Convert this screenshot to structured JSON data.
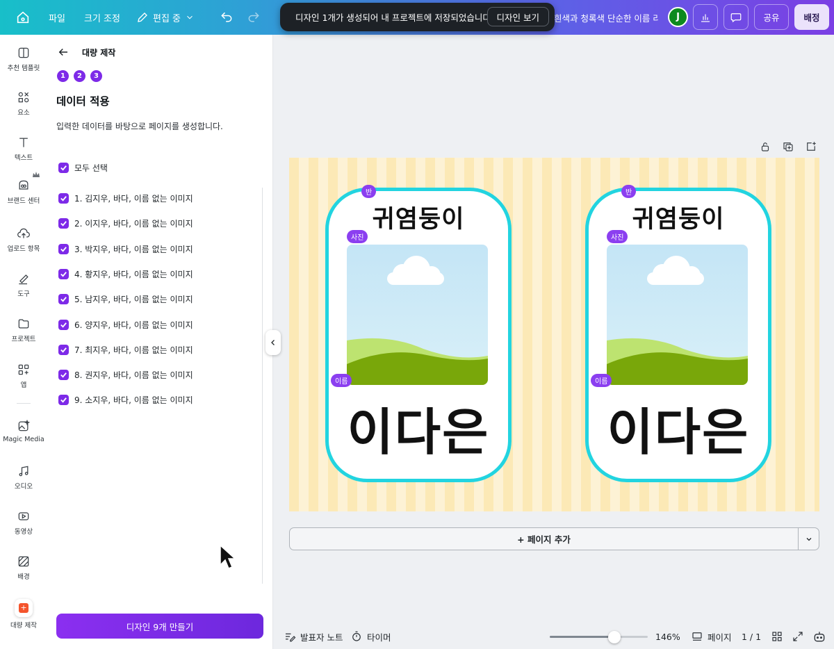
{
  "topbar": {
    "file": "파일",
    "resize": "크기 조정",
    "editing": "편집 중",
    "doc_title": "흰색과 청록색 단순한 이름 라벨",
    "avatar_initial": "J",
    "share": "공유",
    "publish": "배정"
  },
  "toast": {
    "message": "디자인 1개가 생성되어 내 프로젝트에 저장되었습니다",
    "action": "디자인 보기"
  },
  "rail": {
    "items": [
      {
        "label": "추천 템플릿"
      },
      {
        "label": "요소"
      },
      {
        "label": "텍스트"
      },
      {
        "label": "브랜드 센터"
      },
      {
        "label": "업로드 항목"
      },
      {
        "label": "도구"
      },
      {
        "label": "프로젝트"
      },
      {
        "label": "앱"
      },
      {
        "label": "Magic Media"
      },
      {
        "label": "오디오"
      },
      {
        "label": "동영상"
      },
      {
        "label": "배경"
      },
      {
        "label": "대량 제작"
      }
    ]
  },
  "panel": {
    "header": "대량 제작",
    "steps": [
      "1",
      "2",
      "3"
    ],
    "title": "데이터 적용",
    "description": "입력한 데이터를 바탕으로 페이지를 생성합니다.",
    "select_all": "모두 선택",
    "rows": [
      "1. 김지우, 바다, 이름 없는 이미지",
      "2. 이지우, 바다, 이름 없는 이미지",
      "3. 박지우, 바다, 이름 없는 이미지",
      "4. 황지우, 바다, 이름 없는 이미지",
      "5. 남지우, 바다, 이름 없는 이미지",
      "6. 양지우, 바다, 이름 없는 이미지",
      "7. 최지우, 바다, 이름 없는 이미지",
      "8. 권지우, 바다, 이름 없는 이미지",
      "9. 소지우, 바다, 이름 없는 이미지"
    ],
    "make_button": "디자인 9개 만들기"
  },
  "canvas": {
    "cards": [
      {
        "tag_class": "반",
        "title": "귀염둥이",
        "tag_photo": "사진",
        "tag_name": "이름",
        "name": "이다은"
      },
      {
        "tag_class": "반",
        "title": "귀염둥이",
        "tag_photo": "사진",
        "tag_name": "이름",
        "name": "이다은"
      }
    ],
    "add_page": "+ 페이지 추가"
  },
  "bottombar": {
    "notes": "발표자 노트",
    "timer": "타이머",
    "zoom": "146%",
    "zoom_fraction": 0.66,
    "pages_label": "페이지",
    "page_count": "1 / 1"
  },
  "colors": {
    "accent": "#7d2ae8",
    "card_border": "#22d4e0",
    "stripe_a": "#fce9b6",
    "stripe_b": "#fdf2d5"
  }
}
